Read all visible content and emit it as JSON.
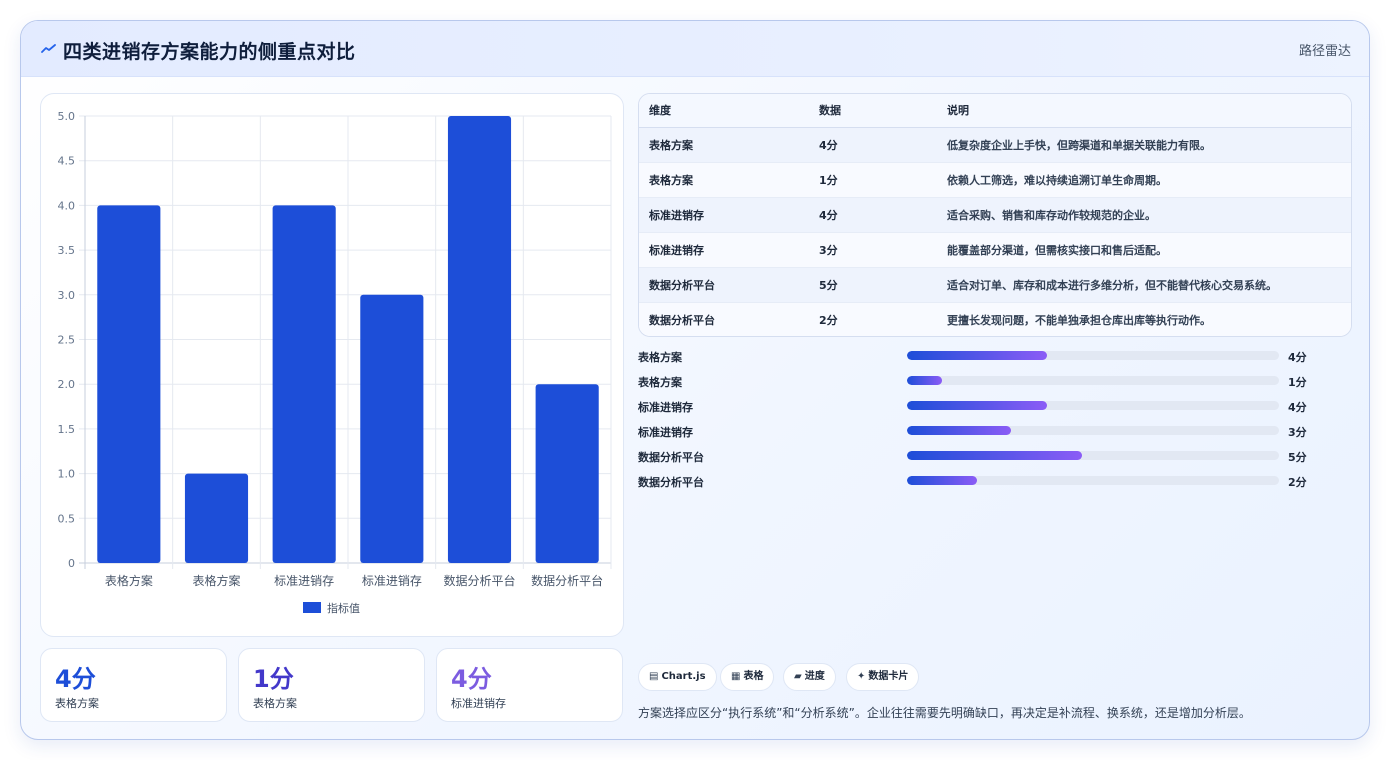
{
  "header": {
    "title": "四类进销存方案能力的侧重点对比",
    "route": "路径雷达"
  },
  "chart_data": {
    "type": "bar",
    "categories": [
      "表格方案",
      "表格方案",
      "标准进销存",
      "标准进销存",
      "数据分析平台",
      "数据分析平台"
    ],
    "series": [
      {
        "name": "指标值",
        "values": [
          4,
          1,
          4,
          3,
          5,
          2
        ]
      }
    ],
    "ylim": [
      0,
      5
    ],
    "yticks": [
      0,
      0.5,
      1.0,
      1.5,
      2.0,
      2.5,
      3.0,
      3.5,
      4.0,
      4.5,
      5.0
    ],
    "ytick_labels": [
      "0",
      "0.5",
      "1.0",
      "1.5",
      "2.0",
      "2.5",
      "3.0",
      "3.5",
      "4.0",
      "4.5",
      "5.0"
    ],
    "grid": true,
    "legend": "bottom",
    "color": "#1d4ed8"
  },
  "stats": [
    {
      "value": "4分",
      "label": "表格方案",
      "color": "#1d4ed8"
    },
    {
      "value": "1分",
      "label": "表格方案",
      "color": "#4338ca"
    },
    {
      "value": "4分",
      "label": "标准进销存",
      "color": "#7c5ce0"
    }
  ],
  "table": {
    "headers": [
      "维度",
      "数据",
      "说明"
    ],
    "rows": [
      {
        "dim": "表格方案",
        "data": "4分",
        "desc": "低复杂度企业上手快，但跨渠道和单据关联能力有限。"
      },
      {
        "dim": "表格方案",
        "data": "1分",
        "desc": "依赖人工筛选，难以持续追溯订单生命周期。"
      },
      {
        "dim": "标准进销存",
        "data": "4分",
        "desc": "适合采购、销售和库存动作较规范的企业。"
      },
      {
        "dim": "标准进销存",
        "data": "3分",
        "desc": "能覆盖部分渠道，但需核实接口和售后适配。"
      },
      {
        "dim": "数据分析平台",
        "data": "5分",
        "desc": "适合对订单、库存和成本进行多维分析，但不能替代核心交易系统。"
      },
      {
        "dim": "数据分析平台",
        "data": "2分",
        "desc": "更擅长发现问题，不能单独承担仓库出库等执行动作。"
      }
    ]
  },
  "progress": [
    {
      "label": "表格方案",
      "value": "4分",
      "fraction": 0.375
    },
    {
      "label": "表格方案",
      "value": "1分",
      "fraction": 0.094
    },
    {
      "label": "标准进销存",
      "value": "4分",
      "fraction": 0.375
    },
    {
      "label": "标准进销存",
      "value": "3分",
      "fraction": 0.28
    },
    {
      "label": "数据分析平台",
      "value": "5分",
      "fraction": 0.47
    },
    {
      "label": "数据分析平台",
      "value": "2分",
      "fraction": 0.188
    }
  ],
  "tags": [
    {
      "icon": "▤",
      "icon_name": "chart-icon",
      "label": "Chart.js"
    },
    {
      "icon": "▦",
      "icon_name": "table-icon",
      "label": "表格"
    },
    {
      "icon": "▰",
      "icon_name": "progress-icon",
      "label": "进度"
    },
    {
      "icon": "✦",
      "icon_name": "sparkle-icon",
      "label": "数据卡片"
    }
  ],
  "note": "方案选择应区分“执行系统”和“分析系统”。企业往往需要先明确缺口，再决定是补流程、换系统，还是增加分析层。"
}
